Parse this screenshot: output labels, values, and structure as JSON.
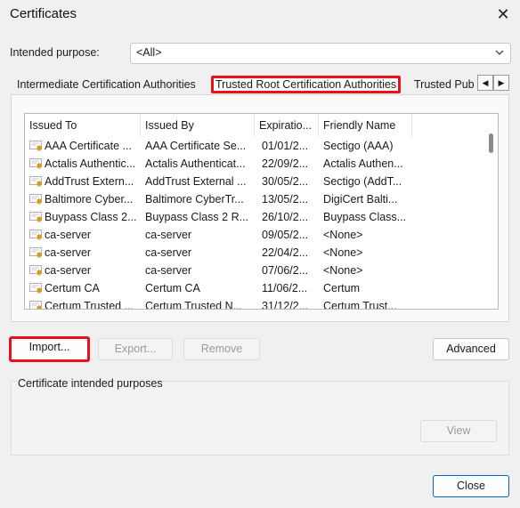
{
  "window": {
    "title": "Certificates",
    "close_glyph": "✕"
  },
  "intended_purpose": {
    "label": "Intended purpose:",
    "value": "<All>"
  },
  "tabs": [
    {
      "label": "Intermediate Certification Authorities",
      "selected": false
    },
    {
      "label": "Trusted Root Certification Authorities",
      "selected": true
    },
    {
      "label": "Trusted Publishers",
      "selected": false
    }
  ],
  "tab_scroll": {
    "left_glyph": "◀",
    "right_glyph": "▶"
  },
  "table": {
    "columns": [
      "Issued To",
      "Issued By",
      "Expiratio...",
      "Friendly Name"
    ],
    "rows": [
      [
        "AAA Certificate ...",
        "AAA Certificate Se...",
        "01/01/2...",
        "Sectigo (AAA)"
      ],
      [
        "Actalis Authentic...",
        "Actalis Authenticat...",
        "22/09/2...",
        "Actalis Authen..."
      ],
      [
        "AddTrust Extern...",
        "AddTrust External ...",
        "30/05/2...",
        "Sectigo (AddT..."
      ],
      [
        "Baltimore Cyber...",
        "Baltimore CyberTr...",
        "13/05/2...",
        "DigiCert Balti..."
      ],
      [
        "Buypass Class 2...",
        "Buypass Class 2 R...",
        "26/10/2...",
        "Buypass Class..."
      ],
      [
        "ca-server",
        "ca-server",
        "09/05/2...",
        "<None>"
      ],
      [
        "ca-server",
        "ca-server",
        "22/04/2...",
        "<None>"
      ],
      [
        "ca-server",
        "ca-server",
        "07/06/2...",
        "<None>"
      ],
      [
        "Certum CA",
        "Certum CA",
        "11/06/2...",
        "Certum"
      ],
      [
        "Certum Trusted ...",
        "Certum Trusted N...",
        "31/12/2...",
        "Certum Trust..."
      ]
    ]
  },
  "buttons": {
    "import": "Import...",
    "export": "Export...",
    "remove": "Remove",
    "advanced": "Advanced",
    "view": "View",
    "close": "Close"
  },
  "purposes_group": {
    "label": "Certificate intended purposes"
  },
  "colors": {
    "highlight": "#e8111b",
    "accent": "#0067c0",
    "cert_icon": "#d59a18"
  }
}
